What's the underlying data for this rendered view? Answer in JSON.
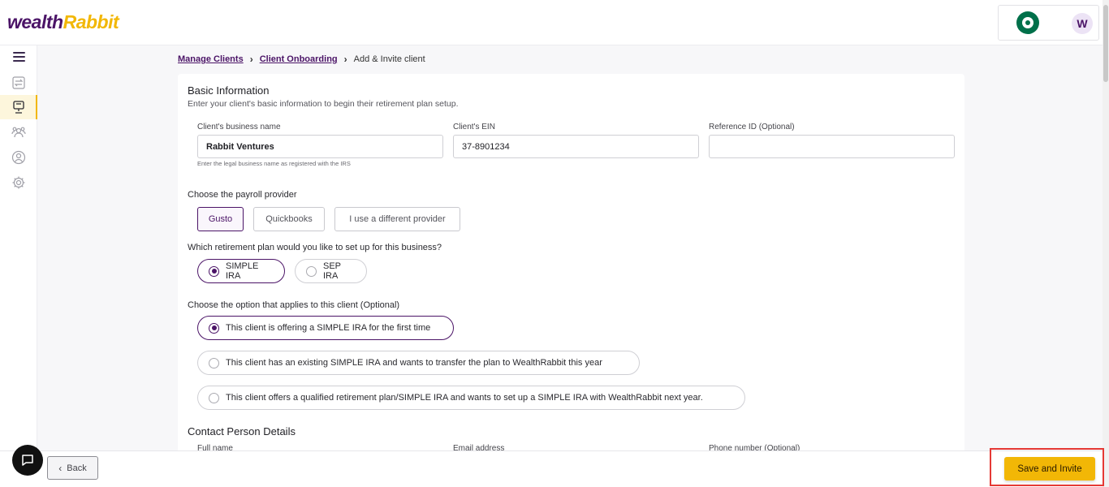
{
  "brand": {
    "logo_part1": "wealth",
    "logo_part2": "Rabbit",
    "primary": "#4b1467",
    "accent": "#f2b706"
  },
  "account": {
    "avatar_initial": "W",
    "company_logo": "starbucks-logo-icon"
  },
  "sidebar": {
    "icons": [
      "menu-icon",
      "transfer-icon",
      "clients-icon",
      "team-icon",
      "profile-icon",
      "settings-icon"
    ],
    "active": "clients-icon"
  },
  "breadcrumb": {
    "items": [
      "Manage Clients",
      "Client Onboarding"
    ],
    "current": "Add & Invite client"
  },
  "basic": {
    "title": "Basic Information",
    "subtitle": "Enter your client's basic information to begin their retirement plan setup.",
    "business_name": {
      "label": "Client's business name",
      "value": "Rabbit Ventures",
      "help": "Enter the legal business name as registered with the IRS"
    },
    "ein": {
      "label": "Client's EIN",
      "value": "37-8901234"
    },
    "reference": {
      "label": "Reference ID (Optional)",
      "value": ""
    }
  },
  "payroll": {
    "question": "Choose the payroll provider",
    "options": [
      "Gusto",
      "Quickbooks",
      "I use a different provider"
    ],
    "selected": "Gusto"
  },
  "plan": {
    "question": "Which retirement plan would you like to set up for this business?",
    "options": [
      "SIMPLE IRA",
      "SEP IRA"
    ],
    "selected": "SIMPLE IRA"
  },
  "client_option": {
    "question": "Choose the option that applies to this client (Optional)",
    "options": [
      "This client is offering a SIMPLE IRA for the first time",
      "This client has an existing SIMPLE IRA and wants to transfer the plan to WealthRabbit this year",
      "This client offers a qualified retirement plan/SIMPLE IRA and wants to set up a SIMPLE IRA with WealthRabbit next year."
    ],
    "selected_index": 0
  },
  "contact": {
    "title": "Contact Person Details",
    "full_name_label": "Full name",
    "email_label": "Email address",
    "phone_label": "Phone number (Optional)"
  },
  "footer": {
    "back_label": "Back",
    "save_label": "Save and Invite"
  }
}
